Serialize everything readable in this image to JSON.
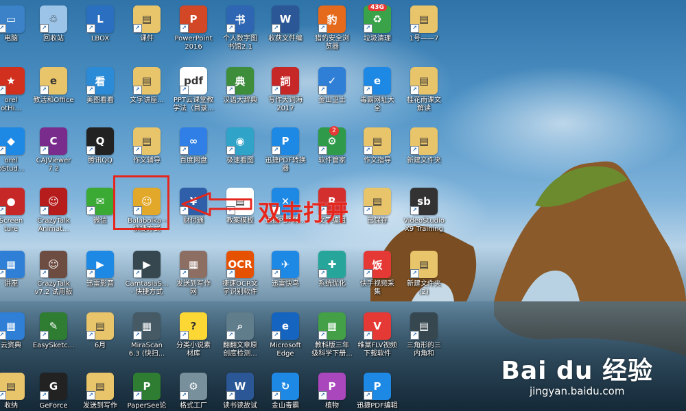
{
  "desktop": {
    "icons": [
      {
        "label": "电脑",
        "color": "#3b82c8",
        "glyph": "▭"
      },
      {
        "label": "回收站",
        "color": "#9cc4e8",
        "glyph": "♲"
      },
      {
        "label": "LBOX",
        "color": "#2a6fc0",
        "glyph": "L"
      },
      {
        "label": "课件",
        "color": "#e8c46a",
        "glyph": "▤"
      },
      {
        "label": "PowerPoint\n2016",
        "color": "#d24726",
        "glyph": "P"
      },
      {
        "label": "个人数字图\n书馆2.1",
        "color": "#2f66b3",
        "glyph": "书"
      },
      {
        "label": "收获文件编",
        "color": "#2b5797",
        "glyph": "W"
      },
      {
        "label": "猎豹安全浏\n览器",
        "color": "#e56a1c",
        "glyph": "豹"
      },
      {
        "label": "垃圾清理",
        "color": "#3aa34a",
        "glyph": "♻"
      },
      {
        "label": "1号——7",
        "color": "#e8c46a",
        "glyph": "▤"
      },
      {
        "label": "orel\notHi...",
        "color": "#d1301f",
        "glyph": "★"
      },
      {
        "label": "教活和Office",
        "color": "#e8c46a",
        "glyph": "e"
      },
      {
        "label": "美图看看",
        "color": "#2b8bd6",
        "glyph": "看"
      },
      {
        "label": "文字讲座...",
        "color": "#e8c46a",
        "glyph": "▤"
      },
      {
        "label": "PPT云课堂教\n学法（目录...",
        "color": "#ffffff",
        "glyph": "pdf"
      },
      {
        "label": "汉语大辞典",
        "color": "#3d8d3a",
        "glyph": "典"
      },
      {
        "label": "写作大词海\n2017",
        "color": "#c62828",
        "glyph": "詞"
      },
      {
        "label": "金山卫士",
        "color": "#2f7fd6",
        "glyph": "✓"
      },
      {
        "label": "毒霸网址大\n全",
        "color": "#1e88e5",
        "glyph": "e"
      },
      {
        "label": "桂花雨课文\n解读",
        "color": "#e8c46a",
        "glyph": "▤"
      },
      {
        "label": "orel\noStud...",
        "color": "#1e88e5",
        "glyph": "◆"
      },
      {
        "label": "CAJViewer\n7.2",
        "color": "#7a2c8c",
        "glyph": "C"
      },
      {
        "label": "腾讯QQ",
        "color": "#222222",
        "glyph": "Q"
      },
      {
        "label": "作文辅导",
        "color": "#e8c46a",
        "glyph": "▤"
      },
      {
        "label": "百度网盘",
        "color": "#2f7fe6",
        "glyph": "∞"
      },
      {
        "label": "极速看图",
        "color": "#2fa3c8",
        "glyph": "◉"
      },
      {
        "label": "迅捷PDF转换\n器",
        "color": "#1e88e5",
        "glyph": "P"
      },
      {
        "label": "软件管家",
        "color": "#2f9b4a",
        "glyph": "⚙"
      },
      {
        "label": "作文指导",
        "color": "#e8c46a",
        "glyph": "▤"
      },
      {
        "label": "新建文件夹",
        "color": "#e8c46a",
        "glyph": "▤"
      },
      {
        "label": "Screen\nture",
        "color": "#c62828",
        "glyph": "●"
      },
      {
        "label": "CrazyTalk\nAnimat...",
        "color": "#b71c1c",
        "glyph": "☺"
      },
      {
        "label": "微信",
        "color": "#3aaa35",
        "glyph": "✉"
      },
      {
        "label": "Balabolka -\n快捷方式",
        "color": "#e2a82a",
        "glyph": "☺"
      },
      {
        "label": "财付通",
        "color": "#2f5fa8",
        "glyph": "¥"
      },
      {
        "label": "教案模板",
        "color": "#ffffff",
        "glyph": "▤"
      },
      {
        "label": "迅捷PDF转...",
        "color": "#1e88e5",
        "glyph": "✕"
      },
      {
        "label": "文字编辑",
        "color": "#d32f2f",
        "glyph": "R"
      },
      {
        "label": "已保存",
        "color": "#e8c46a",
        "glyph": "▤"
      },
      {
        "label": "VideoStudio\nX9 Training",
        "color": "#333333",
        "glyph": "sb"
      },
      {
        "label": "讲座",
        "color": "#2f7fd6",
        "glyph": "▦"
      },
      {
        "label": "CrazyTalk\nv7.2 试用版",
        "color": "#6d4c41",
        "glyph": "☺"
      },
      {
        "label": "迅雷影音",
        "color": "#1e88e5",
        "glyph": "▶"
      },
      {
        "label": "CamtasiaS...\n- 快捷方式",
        "color": "#37474f",
        "glyph": "▶"
      },
      {
        "label": "发送到写作\n网",
        "color": "#8d6e63",
        "glyph": "▦"
      },
      {
        "label": "捷速OCR文\n字识别软件",
        "color": "#e65100",
        "glyph": "OCR"
      },
      {
        "label": "迅雷快鸟",
        "color": "#1e88e5",
        "glyph": "✈"
      },
      {
        "label": "系统优化",
        "color": "#26a69a",
        "glyph": "✚"
      },
      {
        "label": "快手视频采\n集",
        "color": "#e53935",
        "glyph": "饭"
      },
      {
        "label": "新建文件夹\n(2)",
        "color": "#e8c46a",
        "glyph": "▤"
      },
      {
        "label": "云资典",
        "color": "#2f7fd6",
        "glyph": "▦"
      },
      {
        "label": "EasySketc...",
        "color": "#2e7d32",
        "glyph": "✎"
      },
      {
        "label": "6月",
        "color": "#e8c46a",
        "glyph": "▤"
      },
      {
        "label": "MiraScan\n6.3 (快扫...",
        "color": "#455a64",
        "glyph": "▦"
      },
      {
        "label": "分类小说素\n材库",
        "color": "#fdd835",
        "glyph": "?"
      },
      {
        "label": "翻翻文章原\n创度检测...",
        "color": "#607d8b",
        "glyph": "⌕"
      },
      {
        "label": "Microsoft\nEdge",
        "color": "#1565c0",
        "glyph": "e"
      },
      {
        "label": "教科版三年\n级科学下册...",
        "color": "#43a047",
        "glyph": "▦"
      },
      {
        "label": "维棠FLV视频\n下载软件",
        "color": "#e53935",
        "glyph": "V"
      },
      {
        "label": "三角形的三\n内角和",
        "color": "#37474f",
        "glyph": "▤"
      },
      {
        "label": "收纳",
        "color": "#e8c46a",
        "glyph": "▤"
      },
      {
        "label": "GeForce",
        "color": "#222222",
        "glyph": "G"
      },
      {
        "label": "发送到写作",
        "color": "#e8c46a",
        "glyph": "▤"
      },
      {
        "label": "PaperSee论",
        "color": "#2e7d32",
        "glyph": "P"
      },
      {
        "label": "格式工厂",
        "color": "#78909c",
        "glyph": "⚙"
      },
      {
        "label": "读书读故试",
        "color": "#2b5797",
        "glyph": "W"
      },
      {
        "label": "金山毒霸",
        "color": "#1e88e5",
        "glyph": "↻"
      },
      {
        "label": "植物",
        "color": "#ab47bc",
        "glyph": "P"
      },
      {
        "label": "迅捷PDF编辑",
        "color": "#1e88e5",
        "glyph": "P"
      }
    ],
    "recycle_badge": "43G",
    "notif_badge": "2"
  },
  "annotation": {
    "text": "双击打开"
  },
  "watermark": {
    "logo": "Bai du 经验",
    "url": "jingyan.baidu.com"
  }
}
